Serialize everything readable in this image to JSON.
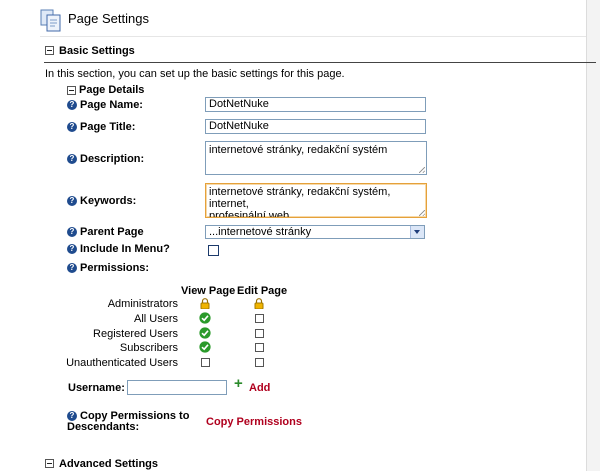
{
  "header": {
    "title": "Page Settings"
  },
  "basic": {
    "label": "Basic Settings",
    "intro": "In this section, you can set up the basic settings for this page.",
    "details_label": "Page Details",
    "fields": {
      "page_name": {
        "label": "Page Name:",
        "value": "DotNetNuke"
      },
      "page_title": {
        "label": "Page Title:",
        "value": "DotNetNuke"
      },
      "description": {
        "label": "Description:",
        "value": "internetové stránky, redakční systém"
      },
      "keywords": {
        "label": "Keywords:",
        "value_line1": "internetové stránky, redakční systém, internet,",
        "value_line2_a": "profesinální",
        "value_line2_b": " web"
      },
      "parent_page": {
        "label": "Parent Page",
        "value": "...internetové stránky"
      },
      "include_menu": {
        "label": "Include In Menu?"
      },
      "permissions": {
        "label": "Permissions:"
      }
    },
    "perm_table": {
      "col_view": "View Page",
      "col_edit": "Edit Page",
      "rows": [
        {
          "role": "Administrators",
          "view": "locked",
          "edit": "locked"
        },
        {
          "role": "All Users",
          "view": "granted",
          "edit": "unchecked"
        },
        {
          "role": "Registered Users",
          "view": "granted",
          "edit": "unchecked"
        },
        {
          "role": "Subscribers",
          "view": "granted",
          "edit": "unchecked"
        },
        {
          "role": "Unauthenticated Users",
          "view": "unchecked",
          "edit": "unchecked"
        }
      ]
    },
    "username": {
      "label": "Username:",
      "value": "",
      "add_label": "Add"
    },
    "copy_perms": {
      "label_line1": "Copy Permissions to",
      "label_line2": "Descendants:",
      "link": "Copy Permissions"
    }
  },
  "advanced": {
    "label": "Advanced Settings"
  },
  "colors": {
    "link": "#b0001e",
    "help": "#1f4b8e",
    "grant": "#2a9a2a",
    "lock": "#e0a400"
  }
}
